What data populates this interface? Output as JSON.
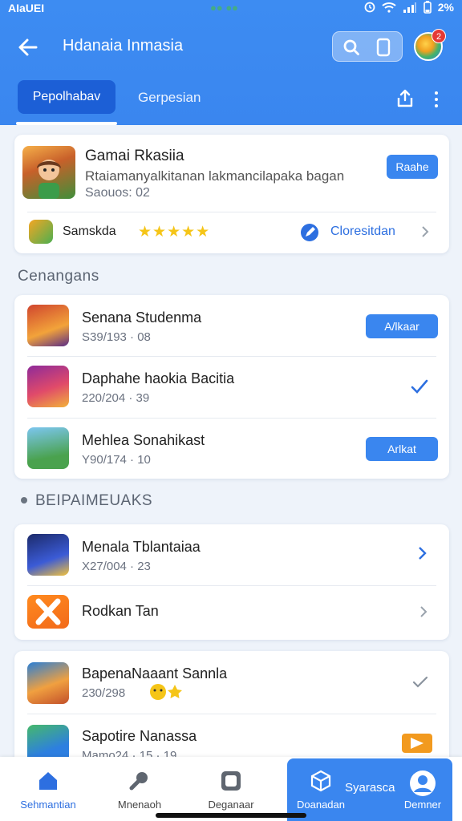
{
  "status_bar": {
    "carrier": "AIаUEI",
    "center": "●● ●●",
    "battery": "2%"
  },
  "app_bar": {
    "title": "Hdanaia Inmasia"
  },
  "tabs": [
    {
      "label": "Pepolhabav"
    },
    {
      "label": "Gerpesian"
    }
  ],
  "featured": {
    "title": "Gamai Rkasiia",
    "description": "Rtaiamanyalkitanan lakmancilapaka bagan",
    "meta": "Saouos: 02",
    "button": "Raahe",
    "footer_name": "Samskda",
    "footer_stars": "★★★★★",
    "footer_link": "Cloresitdan"
  },
  "section1": {
    "label": "Cenangans",
    "items": [
      {
        "title": "Senana Studenma",
        "meta": "S39/193 · 08",
        "button": "A/lkaar"
      },
      {
        "title": "Daphahe haokia Bacitia",
        "meta": "220/204 · 39",
        "button": ""
      },
      {
        "title": "Mehlea Sonahikast",
        "meta": "Y90/174 · 10",
        "button": "Arlkat"
      }
    ]
  },
  "section2": {
    "label": "BEIPAIMEUAKS",
    "items": [
      {
        "title": "Menala Tblantaiaa",
        "meta": "X27/004 · 23"
      },
      {
        "title": "Rodkan Tan",
        "meta": ""
      }
    ]
  },
  "section3": {
    "items": [
      {
        "title": "BapenaNaaant Sannla",
        "meta": "230/298"
      },
      {
        "title": "Sapotire Nanassa",
        "meta": "Mamo24 · 15 · 19"
      }
    ]
  },
  "bottom_nav": [
    {
      "label": "Sehmantian"
    },
    {
      "label": "Mnenaoh"
    },
    {
      "label": "Deganaar"
    },
    {
      "label": "Doanadan"
    },
    {
      "label": "Syarasca"
    },
    {
      "label": "Demner"
    }
  ],
  "colors": {
    "primary": "#3a86ef",
    "primary_dark": "#1c5fd6",
    "background": "#eef3fa"
  }
}
